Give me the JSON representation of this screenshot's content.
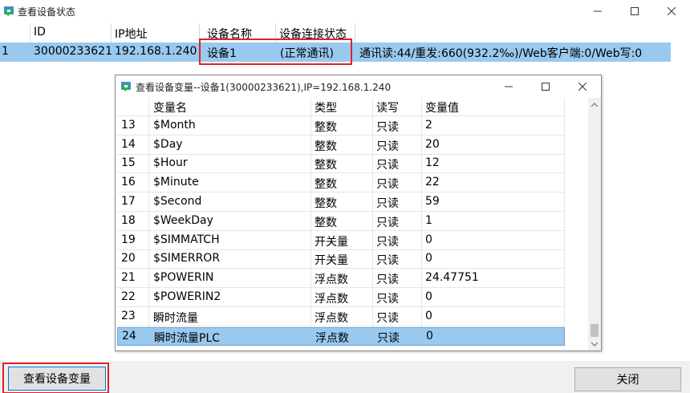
{
  "window": {
    "title": "查看设备状态"
  },
  "main_table": {
    "columns": [
      "ID",
      "IP地址",
      "设备名称",
      "设备连接状态"
    ],
    "row": {
      "index": "1",
      "id": "30000233621",
      "ip": "192.168.1.240",
      "name": "设备1",
      "status": "(正常通讯)",
      "stats": "通讯读:44/重发:660(932.2‰)/Web客户端:0/Web写:0"
    }
  },
  "dialog": {
    "title": "查看设备变量--设备1(30000233621),IP=192.168.1.240",
    "columns": [
      "变量名",
      "类型",
      "读写",
      "变量值"
    ],
    "rows": [
      {
        "no": "13",
        "name": "$Month",
        "type": "整数",
        "rw": "只读",
        "value": "2"
      },
      {
        "no": "14",
        "name": "$Day",
        "type": "整数",
        "rw": "只读",
        "value": "20"
      },
      {
        "no": "15",
        "name": "$Hour",
        "type": "整数",
        "rw": "只读",
        "value": "12"
      },
      {
        "no": "16",
        "name": "$Minute",
        "type": "整数",
        "rw": "只读",
        "value": "22"
      },
      {
        "no": "17",
        "name": "$Second",
        "type": "整数",
        "rw": "只读",
        "value": "59"
      },
      {
        "no": "18",
        "name": "$WeekDay",
        "type": "整数",
        "rw": "只读",
        "value": "1"
      },
      {
        "no": "19",
        "name": "$SIMMATCH",
        "type": "开关量",
        "rw": "只读",
        "value": "0"
      },
      {
        "no": "20",
        "name": "$SIMERROR",
        "type": "开关量",
        "rw": "只读",
        "value": "0"
      },
      {
        "no": "21",
        "name": "$POWERIN",
        "type": "浮点数",
        "rw": "只读",
        "value": "24.47751"
      },
      {
        "no": "22",
        "name": "$POWERIN2",
        "type": "浮点数",
        "rw": "只读",
        "value": "0"
      },
      {
        "no": "23",
        "name": "瞬时流量",
        "type": "浮点数",
        "rw": "只读",
        "value": "0"
      },
      {
        "no": "24",
        "name": "瞬时流量PLC",
        "type": "浮点数",
        "rw": "只读",
        "value": "0"
      }
    ],
    "selected_row": "24"
  },
  "buttons": {
    "view_vars": "查看设备变量",
    "close": "关闭"
  },
  "colors": {
    "selection": "#99c9ef",
    "highlight_box": "#e0212a"
  }
}
